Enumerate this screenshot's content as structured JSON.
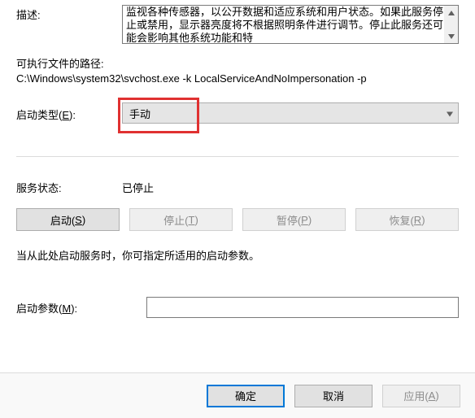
{
  "description": {
    "label": "描述:",
    "text": "监视各种传感器，以公开数据和适应系统和用户状态。如果此服务停止或禁用，显示器亮度将不根据照明条件进行调节。停止此服务还可能会影响其他系统功能和特"
  },
  "path": {
    "label": "可执行文件的路径:",
    "value": "C:\\Windows\\system32\\svchost.exe -k LocalServiceAndNoImpersonation -p"
  },
  "startup": {
    "label_pre": "启动类型(",
    "label_key": "E",
    "label_post": "):",
    "selected": "手动"
  },
  "status": {
    "label": "服务状态:",
    "value": "已停止"
  },
  "buttons": {
    "start_pre": "启动(",
    "start_key": "S",
    "start_post": ")",
    "stop_pre": "停止(",
    "stop_key": "T",
    "stop_post": ")",
    "pause_pre": "暂停(",
    "pause_key": "P",
    "pause_post": ")",
    "resume_pre": "恢复(",
    "resume_key": "R",
    "resume_post": ")"
  },
  "note": "当从此处启动服务时，你可指定所适用的启动参数。",
  "params": {
    "label_pre": "启动参数(",
    "label_key": "M",
    "label_post": "):",
    "value": ""
  },
  "footer": {
    "ok": "确定",
    "cancel": "取消",
    "apply_pre": "应用(",
    "apply_key": "A",
    "apply_post": ")"
  }
}
